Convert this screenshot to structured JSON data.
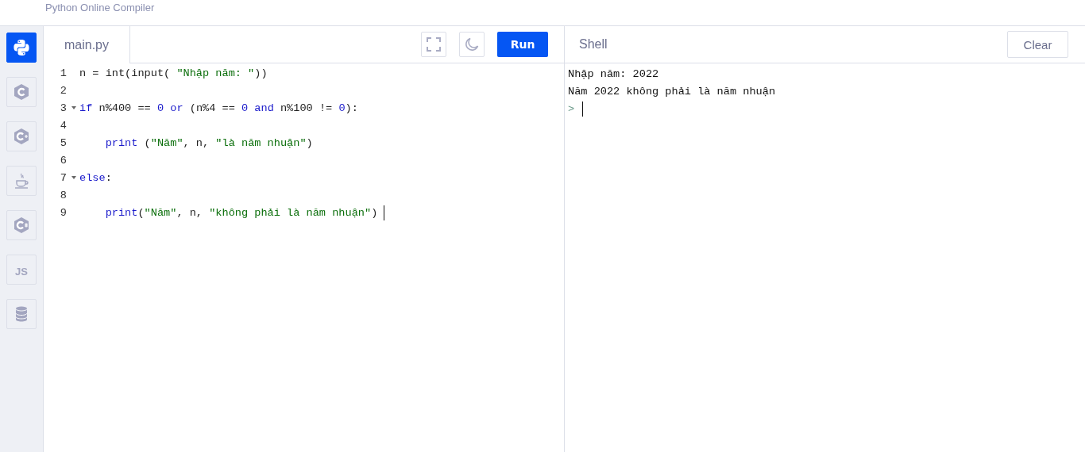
{
  "header": {
    "subtitle": "Python Online Compiler"
  },
  "sidebar": {
    "items": [
      {
        "kind": "python",
        "selected": true
      },
      {
        "kind": "c",
        "selected": false
      },
      {
        "kind": "cpp",
        "selected": false
      },
      {
        "kind": "java",
        "selected": false
      },
      {
        "kind": "csharp",
        "selected": false
      },
      {
        "kind": "js",
        "label": "JS",
        "selected": false
      },
      {
        "kind": "database",
        "selected": false
      }
    ]
  },
  "editor": {
    "tab": {
      "label": "main.py",
      "selected": true
    },
    "run_button": "Run",
    "lines": [
      {
        "number": "1",
        "foldable": false,
        "indented": false,
        "tokens": [
          {
            "kind": "plain",
            "text": "n = int(input( "
          },
          {
            "kind": "string",
            "text": "\"Nhập năm: \""
          },
          {
            "kind": "plain",
            "text": "))"
          }
        ]
      },
      {
        "number": "2",
        "foldable": false
      },
      {
        "number": "3",
        "foldable": true,
        "indented": false,
        "tokens": [
          {
            "kind": "keyword",
            "text": "if"
          },
          {
            "kind": "plain",
            "text": " n%400 == "
          },
          {
            "kind": "number",
            "text": "0 "
          },
          {
            "kind": "keyword",
            "text": "or"
          },
          {
            "kind": "plain",
            "text": " (n%4 == "
          },
          {
            "kind": "number",
            "text": "0 "
          },
          {
            "kind": "keyword",
            "text": "and"
          },
          {
            "kind": "plain",
            "text": " n%100 != "
          },
          {
            "kind": "number",
            "text": "0"
          },
          {
            "kind": "plain",
            "text": "):"
          }
        ]
      },
      {
        "number": "4",
        "foldable": false
      },
      {
        "number": "5",
        "foldable": false,
        "indented": true,
        "tokens": [
          {
            "kind": "keyword",
            "text": "print"
          },
          {
            "kind": "plain",
            "text": " ("
          },
          {
            "kind": "string",
            "text": "\"Năm\""
          },
          {
            "kind": "plain",
            "text": ", n, "
          },
          {
            "kind": "string",
            "text": "\"là năm nhuận\""
          },
          {
            "kind": "plain",
            "text": ")"
          }
        ]
      },
      {
        "number": "6",
        "foldable": false
      },
      {
        "number": "7",
        "foldable": true,
        "indented": false,
        "tokens": [
          {
            "kind": "keyword",
            "text": "else"
          },
          {
            "kind": "plain",
            "text": ":"
          }
        ]
      },
      {
        "number": "8",
        "foldable": false
      },
      {
        "number": "9",
        "foldable": false,
        "indented": true,
        "cursor": true,
        "tokens": [
          {
            "kind": "keyword",
            "text": "print"
          },
          {
            "kind": "plain",
            "text": "("
          },
          {
            "kind": "string",
            "text": "\"Năm\""
          },
          {
            "kind": "plain",
            "text": ", n, "
          },
          {
            "kind": "string",
            "text": "\"không phải là năm nhuận\""
          },
          {
            "kind": "plain",
            "text": ")"
          }
        ]
      }
    ]
  },
  "shell": {
    "title": "Shell",
    "clear_button": "Clear",
    "output": [
      "Nhập năm: 2022",
      "Năm 2022 không phải là năm nhuận"
    ],
    "prompt": ">"
  }
}
